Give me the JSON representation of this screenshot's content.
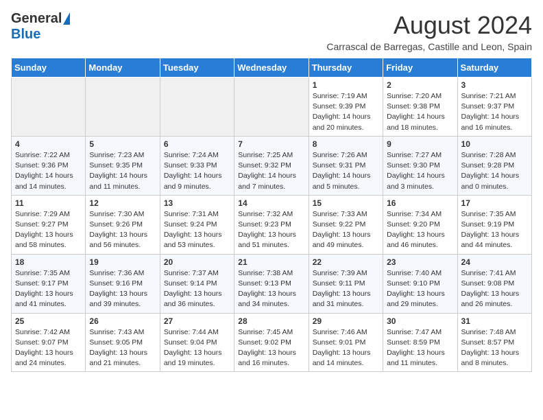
{
  "header": {
    "logo_general": "General",
    "logo_blue": "Blue",
    "month_year": "August 2024",
    "subtitle": "Carrascal de Barregas, Castille and Leon, Spain"
  },
  "weekdays": [
    "Sunday",
    "Monday",
    "Tuesday",
    "Wednesday",
    "Thursday",
    "Friday",
    "Saturday"
  ],
  "weeks": [
    [
      {
        "day": "",
        "empty": true
      },
      {
        "day": "",
        "empty": true
      },
      {
        "day": "",
        "empty": true
      },
      {
        "day": "",
        "empty": true
      },
      {
        "day": "1",
        "sunrise": "7:19 AM",
        "sunset": "9:39 PM",
        "daylight": "14 hours and 20 minutes."
      },
      {
        "day": "2",
        "sunrise": "7:20 AM",
        "sunset": "9:38 PM",
        "daylight": "14 hours and 18 minutes."
      },
      {
        "day": "3",
        "sunrise": "7:21 AM",
        "sunset": "9:37 PM",
        "daylight": "14 hours and 16 minutes."
      }
    ],
    [
      {
        "day": "4",
        "sunrise": "7:22 AM",
        "sunset": "9:36 PM",
        "daylight": "14 hours and 14 minutes."
      },
      {
        "day": "5",
        "sunrise": "7:23 AM",
        "sunset": "9:35 PM",
        "daylight": "14 hours and 11 minutes."
      },
      {
        "day": "6",
        "sunrise": "7:24 AM",
        "sunset": "9:33 PM",
        "daylight": "14 hours and 9 minutes."
      },
      {
        "day": "7",
        "sunrise": "7:25 AM",
        "sunset": "9:32 PM",
        "daylight": "14 hours and 7 minutes."
      },
      {
        "day": "8",
        "sunrise": "7:26 AM",
        "sunset": "9:31 PM",
        "daylight": "14 hours and 5 minutes."
      },
      {
        "day": "9",
        "sunrise": "7:27 AM",
        "sunset": "9:30 PM",
        "daylight": "14 hours and 3 minutes."
      },
      {
        "day": "10",
        "sunrise": "7:28 AM",
        "sunset": "9:28 PM",
        "daylight": "14 hours and 0 minutes."
      }
    ],
    [
      {
        "day": "11",
        "sunrise": "7:29 AM",
        "sunset": "9:27 PM",
        "daylight": "13 hours and 58 minutes."
      },
      {
        "day": "12",
        "sunrise": "7:30 AM",
        "sunset": "9:26 PM",
        "daylight": "13 hours and 56 minutes."
      },
      {
        "day": "13",
        "sunrise": "7:31 AM",
        "sunset": "9:24 PM",
        "daylight": "13 hours and 53 minutes."
      },
      {
        "day": "14",
        "sunrise": "7:32 AM",
        "sunset": "9:23 PM",
        "daylight": "13 hours and 51 minutes."
      },
      {
        "day": "15",
        "sunrise": "7:33 AM",
        "sunset": "9:22 PM",
        "daylight": "13 hours and 49 minutes."
      },
      {
        "day": "16",
        "sunrise": "7:34 AM",
        "sunset": "9:20 PM",
        "daylight": "13 hours and 46 minutes."
      },
      {
        "day": "17",
        "sunrise": "7:35 AM",
        "sunset": "9:19 PM",
        "daylight": "13 hours and 44 minutes."
      }
    ],
    [
      {
        "day": "18",
        "sunrise": "7:35 AM",
        "sunset": "9:17 PM",
        "daylight": "13 hours and 41 minutes."
      },
      {
        "day": "19",
        "sunrise": "7:36 AM",
        "sunset": "9:16 PM",
        "daylight": "13 hours and 39 minutes."
      },
      {
        "day": "20",
        "sunrise": "7:37 AM",
        "sunset": "9:14 PM",
        "daylight": "13 hours and 36 minutes."
      },
      {
        "day": "21",
        "sunrise": "7:38 AM",
        "sunset": "9:13 PM",
        "daylight": "13 hours and 34 minutes."
      },
      {
        "day": "22",
        "sunrise": "7:39 AM",
        "sunset": "9:11 PM",
        "daylight": "13 hours and 31 minutes."
      },
      {
        "day": "23",
        "sunrise": "7:40 AM",
        "sunset": "9:10 PM",
        "daylight": "13 hours and 29 minutes."
      },
      {
        "day": "24",
        "sunrise": "7:41 AM",
        "sunset": "9:08 PM",
        "daylight": "13 hours and 26 minutes."
      }
    ],
    [
      {
        "day": "25",
        "sunrise": "7:42 AM",
        "sunset": "9:07 PM",
        "daylight": "13 hours and 24 minutes."
      },
      {
        "day": "26",
        "sunrise": "7:43 AM",
        "sunset": "9:05 PM",
        "daylight": "13 hours and 21 minutes."
      },
      {
        "day": "27",
        "sunrise": "7:44 AM",
        "sunset": "9:04 PM",
        "daylight": "13 hours and 19 minutes."
      },
      {
        "day": "28",
        "sunrise": "7:45 AM",
        "sunset": "9:02 PM",
        "daylight": "13 hours and 16 minutes."
      },
      {
        "day": "29",
        "sunrise": "7:46 AM",
        "sunset": "9:01 PM",
        "daylight": "13 hours and 14 minutes."
      },
      {
        "day": "30",
        "sunrise": "7:47 AM",
        "sunset": "8:59 PM",
        "daylight": "13 hours and 11 minutes."
      },
      {
        "day": "31",
        "sunrise": "7:48 AM",
        "sunset": "8:57 PM",
        "daylight": "13 hours and 8 minutes."
      }
    ]
  ]
}
